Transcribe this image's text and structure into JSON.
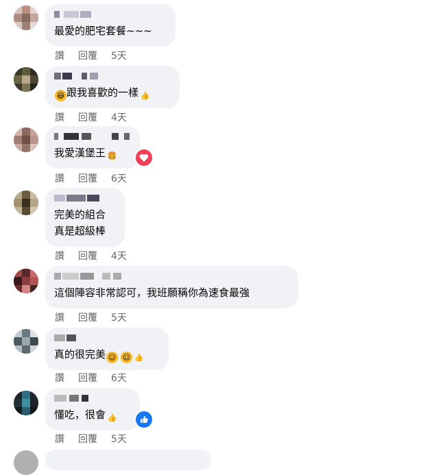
{
  "actions": {
    "like": "讚",
    "reply": "回覆"
  },
  "comments": [
    {
      "text": "最愛的肥宅套餐~~~",
      "time": "5天"
    },
    {
      "text": "跟我喜歡的一樣",
      "time": "4天"
    },
    {
      "text": "我愛漢堡王",
      "time": "6天"
    },
    {
      "line1": "完美的組合",
      "line2": "真是超級棒",
      "time": "4天"
    },
    {
      "text": "這個陣容非常認可，我班願稱你為速食最強",
      "time": "5天"
    },
    {
      "text": "真的很完美",
      "time": "6天"
    },
    {
      "text": "懂吃，很會",
      "time": "5天"
    }
  ],
  "icons": {
    "laugh": "rolling-laugh-emoji",
    "thumb": "thumbs-up-emoji",
    "burger": "hamburger-emoji",
    "smile": "smiling-face-emoji",
    "love_reaction": "heart-reaction",
    "like_reaction": "like-reaction"
  },
  "colors": {
    "bubble": "#f0f2f5",
    "meta": "#65676b",
    "love": "#f33e58",
    "like": "#1877f2"
  }
}
